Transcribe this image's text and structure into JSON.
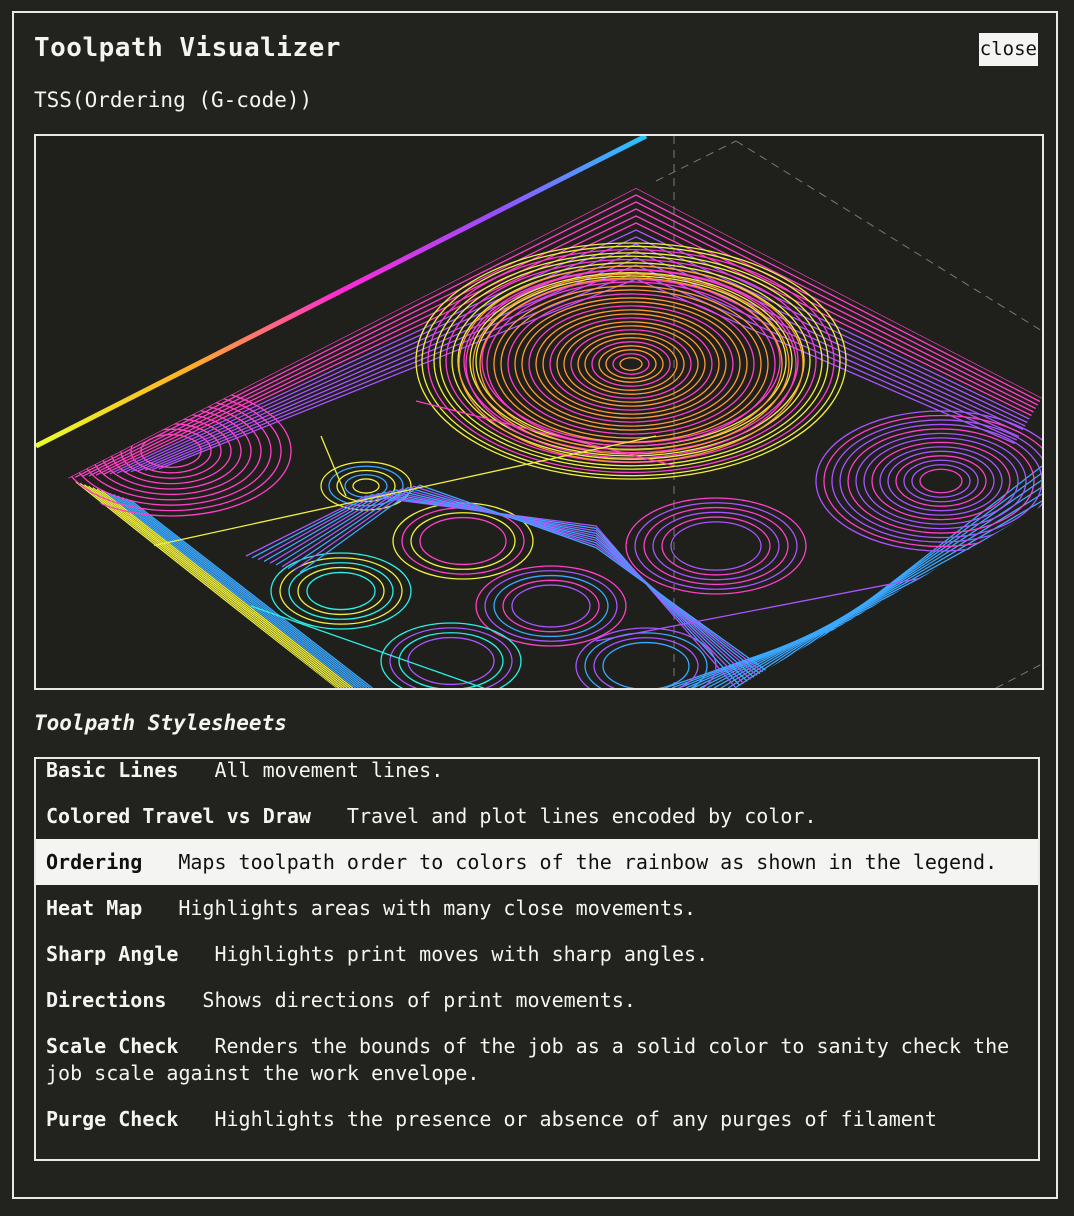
{
  "window": {
    "title": "Toolpath Visualizer",
    "close_label": "close",
    "subtitle": "TSS(Ordering (G-code))"
  },
  "stylesheets": {
    "heading": "Toolpath Stylesheets",
    "selected": "Ordering",
    "items": [
      {
        "name": "Basic Lines",
        "desc": "All movement lines."
      },
      {
        "name": "Colored Travel vs Draw",
        "desc": "Travel and plot lines encoded by color."
      },
      {
        "name": "Ordering",
        "desc": "Maps toolpath order to colors of the rainbow as shown in the legend."
      },
      {
        "name": "Heat Map",
        "desc": "Highlights areas with many close movements."
      },
      {
        "name": "Sharp Angle",
        "desc": "Highlights print moves with sharp angles."
      },
      {
        "name": "Directions",
        "desc": "Shows directions of print movements."
      },
      {
        "name": "Scale Check",
        "desc": "Renders the bounds of the job as a solid color to sanity check the job scale against the work envelope."
      },
      {
        "name": "Purge Check",
        "desc": "Highlights the presence or absence of any purges of filament"
      }
    ]
  },
  "colors": {
    "background": "#22231f",
    "foreground": "#f4f4f2",
    "legend_gradient": [
      "#e8ff2a",
      "#ffb020",
      "#ff2ad4",
      "#9a4dff",
      "#22c8ff"
    ],
    "toolpath": [
      "#ff3fc8",
      "#f0f040",
      "#ff9a3a",
      "#3aa8ff",
      "#a855ff",
      "#29f0e6"
    ]
  }
}
